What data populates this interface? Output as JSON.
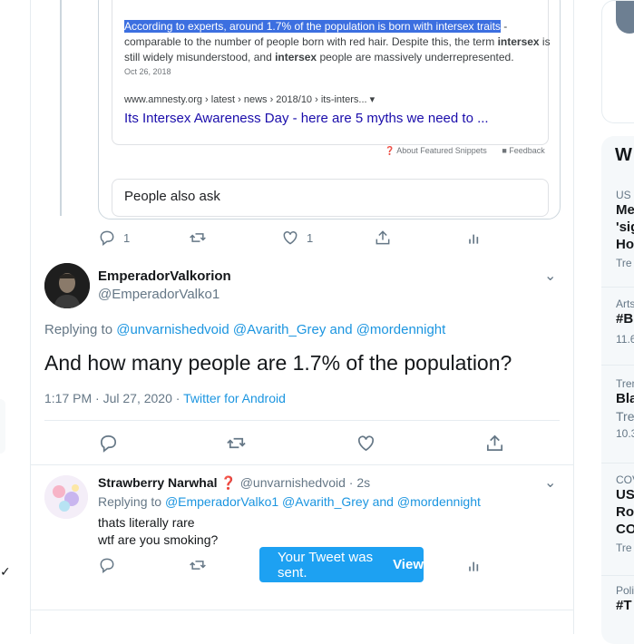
{
  "embedded_search": {
    "snippet_highlight": "According to experts, around 1.7% of the population is born with intersex traits",
    "snippet_text_1": " - comparable to the number of people born with red hair. Despite this, the term ",
    "snippet_bold_1": "intersex",
    "snippet_text_2": " is still widely misunderstood, and ",
    "snippet_bold_2": "intersex",
    "snippet_text_3": " people are massively underrepresented.",
    "date": "Oct 26, 2018",
    "url": "www.amnesty.org › latest › news › 2018/10 › its-inters... ▾",
    "title": "Its Intersex Awareness Day - here are 5 myths we need to ...",
    "footer_about": "About Featured Snippets",
    "footer_feedback": "Feedback",
    "people_also_ask": "People also ask"
  },
  "tweet1_actions": {
    "reply_count": "1",
    "like_count": "1"
  },
  "tweet2": {
    "display_name": "EmperadorValkorion",
    "handle": "@EmperadorValko1",
    "replying_prefix": "Replying to ",
    "replying_users": "@unvarnishedvoid @Avarith_Grey and @mordennight",
    "text": "And how many people are 1.7% of the population?",
    "time": "1:17 PM · Jul 27, 2020 · ",
    "source": "Twitter for Android"
  },
  "tweet3": {
    "display_name": "Strawberry Narwhal ❓",
    "handle": "@unvarnishedvoid · 2s",
    "replying_prefix": "Replying to ",
    "replying_users": "@EmperadorValko1 @Avarith_Grey and @mordennight",
    "line1": "thats literally rare",
    "line2": "wtf are you smoking?"
  },
  "toast": {
    "message": "Your Tweet was sent.",
    "action": "View"
  },
  "sidebar": {
    "header": "W",
    "trends": [
      {
        "cat": "US",
        "name_lines": [
          "Me",
          "'sig",
          "Ho"
        ],
        "sub": "Tre"
      },
      {
        "cat": "Arts",
        "name_lines": [
          "#B"
        ],
        "sub": "11.6"
      },
      {
        "cat": "Tren",
        "name_lines": [
          "Bla"
        ],
        "sub": "Tre",
        "sub2": "10.3"
      },
      {
        "cat": "COV",
        "name_lines": [
          "US",
          "Ro",
          "CO"
        ],
        "sub": "Tre"
      },
      {
        "cat": "Poli",
        "name_lines": [
          "#T"
        ]
      }
    ]
  },
  "colors": {
    "accent": "#1da1f2",
    "link": "#1b95e0",
    "google_title": "#1a0dab",
    "highlight": "#3c6fe0"
  }
}
